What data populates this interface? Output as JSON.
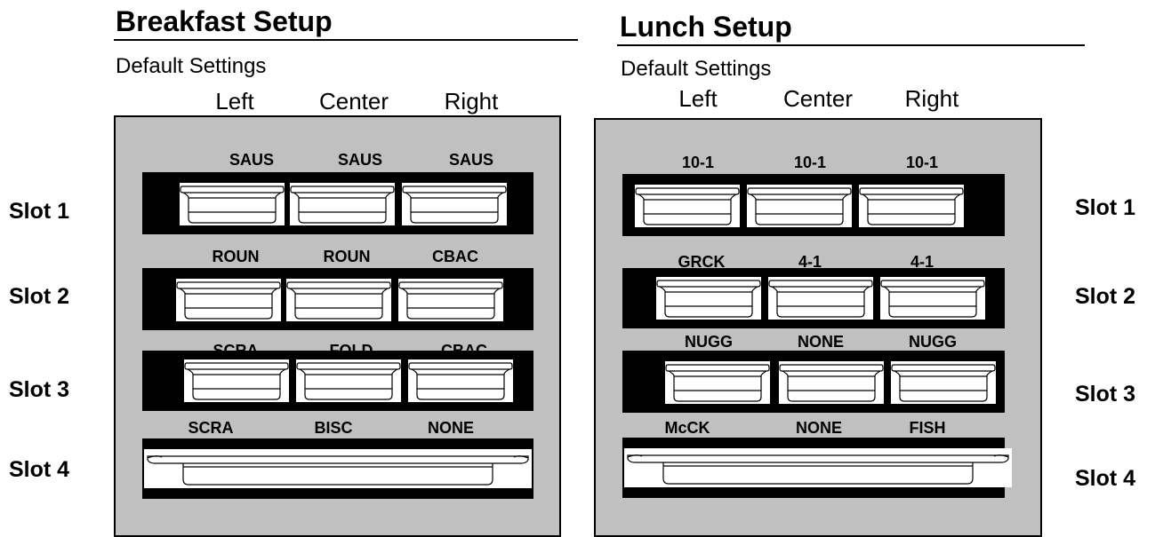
{
  "breakfast": {
    "title": "Breakfast Setup",
    "subtitle": "Default Settings",
    "columns": [
      "Left",
      "Center",
      "Right"
    ],
    "slots": [
      {
        "label": "Slot 1",
        "pans": [
          "SAUS",
          "SAUS",
          "SAUS"
        ]
      },
      {
        "label": "Slot 2",
        "pans": [
          "ROUN",
          "ROUN",
          "CBAC"
        ]
      },
      {
        "label": "Slot 3",
        "pans": [
          "SCRA",
          "FOLD",
          "CBAC"
        ]
      },
      {
        "label": "Slot 4",
        "pans": [
          "SCRA",
          "BISC",
          "NONE"
        ]
      }
    ]
  },
  "lunch": {
    "title": "Lunch Setup",
    "subtitle": "Default Settings",
    "columns": [
      "Left",
      "Center",
      "Right"
    ],
    "slots": [
      {
        "label": "Slot 1",
        "pans": [
          "10-1",
          "10-1",
          "10-1"
        ]
      },
      {
        "label": "Slot 2",
        "pans": [
          "GRCK",
          "4-1",
          "4-1"
        ]
      },
      {
        "label": "Slot 3",
        "pans": [
          "NUGG",
          "NONE",
          "NUGG"
        ]
      },
      {
        "label": "Slot 4",
        "pans": [
          "McCK",
          "NONE",
          "FISH"
        ]
      }
    ]
  },
  "colors": {
    "cabinet": "#c0c0c0",
    "band": "#000000",
    "pan": "#ffffff"
  }
}
